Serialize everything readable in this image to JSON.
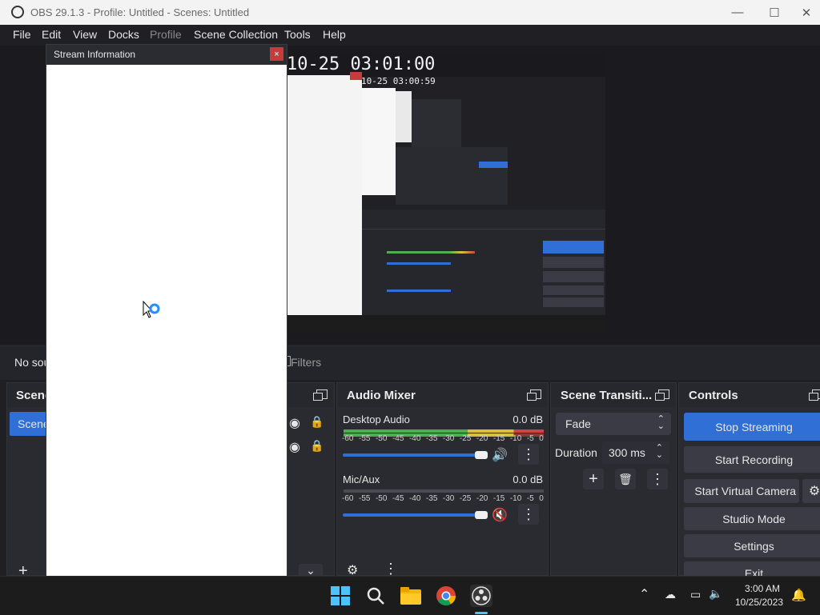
{
  "window": {
    "title": "OBS 29.1.3 - Profile: Untitled - Scenes: Untitled",
    "minimize": "—",
    "maximize": "☐",
    "close": "✕"
  },
  "menu": [
    "File",
    "Edit",
    "View",
    "Docks",
    "Profile",
    "Scene Collection",
    "Tools",
    "Help"
  ],
  "preview": {
    "timestamp_large": "10-25 03:01:00",
    "timestamp_small": "10-25 03:00:59"
  },
  "source_toolbar": {
    "no_source": "No sou",
    "filters": "Filters"
  },
  "scenes_dock": {
    "title": "Scene",
    "item": "Scene",
    "add": "+"
  },
  "sources_dock": {
    "chevron": "⌄"
  },
  "audio_mixer": {
    "title": "Audio Mixer",
    "ticks": [
      "-60",
      "-55",
      "-50",
      "-45",
      "-40",
      "-35",
      "-30",
      "-25",
      "-20",
      "-15",
      "-10",
      "-5",
      "0"
    ],
    "channels": [
      {
        "name": "Desktop Audio",
        "db": "0.0 dB",
        "muted": false
      },
      {
        "name": "Mic/Aux",
        "db": "0.0 dB",
        "muted": true
      }
    ]
  },
  "transitions": {
    "title": "Scene Transiti...",
    "selected": "Fade",
    "duration_label": "Duration",
    "duration_value": "300 ms",
    "add": "+",
    "delete": "🗑",
    "more": "⋮"
  },
  "controls": {
    "title": "Controls",
    "stop_streaming": "Stop Streaming",
    "start_recording": "Start Recording",
    "start_virtual_camera": "Start Virtual Camera",
    "studio_mode": "Studio Mode",
    "settings": "Settings",
    "exit": "Exit"
  },
  "stream_info": {
    "title": "Stream Information",
    "close": "×"
  },
  "taskbar": {
    "time": "3:00 AM",
    "date": "10/25/2023"
  },
  "colors": {
    "accent": "#2f6fd6",
    "primary_button": "#2f6fd6",
    "muted_icon": "#c23b3b"
  }
}
